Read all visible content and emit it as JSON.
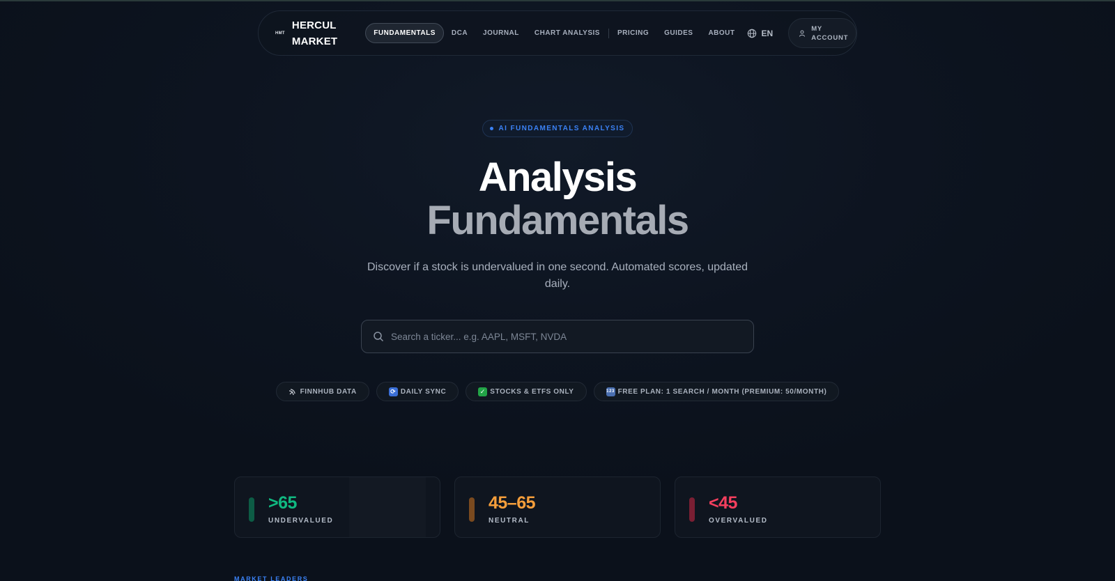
{
  "nav": {
    "logo_mark": "HMT",
    "logo_line1": "HERCUL",
    "logo_line2": "MARKET",
    "links": [
      {
        "label": "FUNDAMENTALS"
      },
      {
        "label": "DCA"
      },
      {
        "label": "JOURNAL"
      },
      {
        "label": "CHART ANALYSIS"
      },
      {
        "label": "PRICING"
      },
      {
        "label": "GUIDES"
      },
      {
        "label": "ABOUT"
      }
    ],
    "language": "EN",
    "account_label": "MY ACCOUNT"
  },
  "hero": {
    "badge": "AI FUNDAMENTALS ANALYSIS",
    "title_line1": "Analysis",
    "title_line2": "Fundamentals",
    "subtitle": "Discover if a stock is undervalued in one second. Automated scores, updated daily."
  },
  "search": {
    "placeholder": "Search a ticker... e.g. AAPL, MSFT, NVDA",
    "value": ""
  },
  "tags": [
    {
      "icon": "satellite-icon",
      "label": "FINNHUB DATA"
    },
    {
      "icon": "sync-icon",
      "label": "DAILY SYNC"
    },
    {
      "icon": "check-icon",
      "label": "STOCKS & ETFS ONLY"
    },
    {
      "icon": "numbers-icon",
      "label": "FREE PLAN: 1 SEARCH / MONTH (PREMIUM: 50/MONTH)"
    }
  ],
  "score_cards": [
    {
      "value": ">65",
      "label": "UNDERVALUED",
      "color": "#10b981",
      "bar_color": "#0d5c45"
    },
    {
      "value": "45–65",
      "label": "NEUTRAL",
      "color": "#f59e3b",
      "bar_color": "#7a4a1f"
    },
    {
      "value": "<45",
      "label": "OVERVALUED",
      "color": "#f43f5e",
      "bar_color": "#7a1f33"
    }
  ],
  "section_label": "MARKET LEADERS",
  "colors": {
    "accent": "#3b82f6",
    "background": "#0c121d"
  }
}
